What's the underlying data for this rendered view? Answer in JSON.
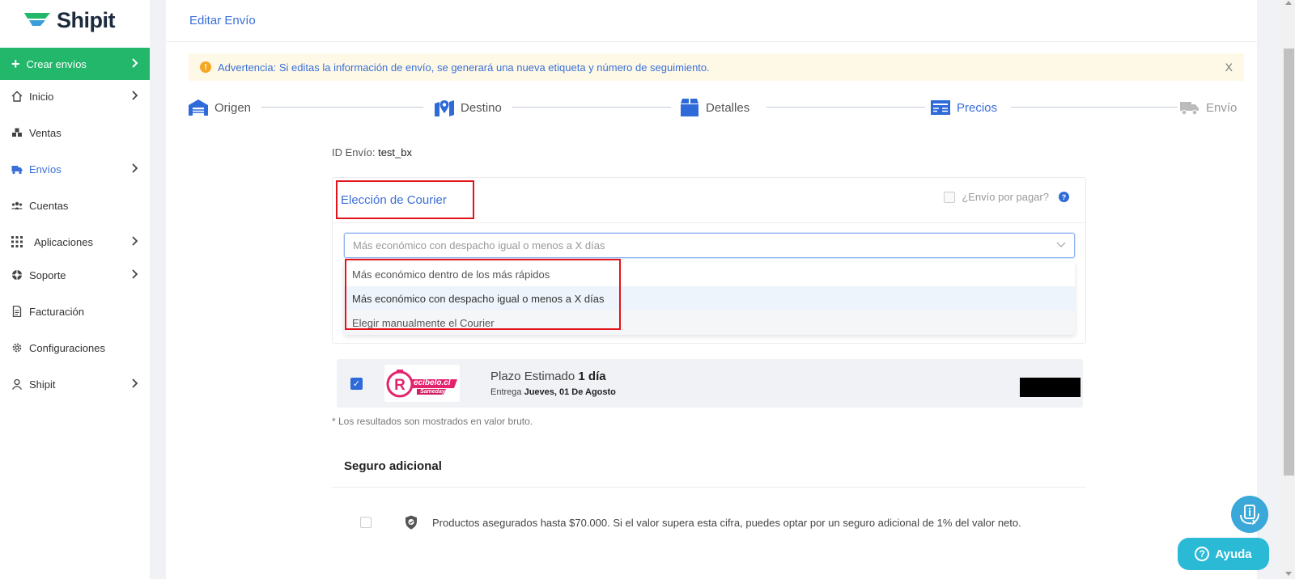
{
  "app": {
    "brand": "Shipit"
  },
  "sidebar": {
    "create_label": "Crear envíos",
    "items": [
      {
        "label": "Inicio",
        "icon": "home-icon",
        "chevron": true
      },
      {
        "label": "Ventas",
        "icon": "boxes-icon",
        "chevron": false
      },
      {
        "label": "Envíos",
        "icon": "truck-icon",
        "chevron": true,
        "active": true
      },
      {
        "label": "Cuentas",
        "icon": "users-icon",
        "chevron": false
      },
      {
        "label": "Aplicaciones",
        "icon": "grid-icon",
        "chevron": true
      },
      {
        "label": "Soporte",
        "icon": "lifebuoy-icon",
        "chevron": true
      },
      {
        "label": "Facturación",
        "icon": "invoice-icon",
        "chevron": false
      },
      {
        "label": "Configuraciones",
        "icon": "gear-icon",
        "chevron": false
      },
      {
        "label": "Shipit",
        "icon": "user-icon",
        "chevron": true
      }
    ]
  },
  "header": {
    "title": "Editar Envío"
  },
  "alert": {
    "text": "Advertencia: Si editas la información de envío, se generará una nueva etiqueta y número de seguimiento.",
    "close": "X"
  },
  "steps": [
    {
      "label": "Origen",
      "icon": "warehouse-icon",
      "state": "done"
    },
    {
      "label": "Destino",
      "icon": "map-pin-icon",
      "state": "done"
    },
    {
      "label": "Detalles",
      "icon": "box-icon",
      "state": "done"
    },
    {
      "label": "Precios",
      "icon": "price-card-icon",
      "state": "current"
    },
    {
      "label": "Envío",
      "icon": "truck-icon",
      "state": "future"
    }
  ],
  "shipment": {
    "id_label": "ID Envío:",
    "id_value": "test_bx"
  },
  "courier_card": {
    "title": "Elección de Courier",
    "pay_label": "¿Envío por pagar?",
    "select_placeholder": "Más económico con despacho igual o menos a X días",
    "options": [
      "Más económico dentro de los más rápidos",
      "Más económico con despacho igual o menos a X días",
      "Elegir manualmente el Courier"
    ]
  },
  "courier_result": {
    "logo_text": "ecibelo.cl",
    "logo_sub": "Sameday",
    "plazo_label": "Plazo Estimado",
    "plazo_value": "1 día",
    "entrega_label": "Entrega",
    "entrega_value": "Jueves, 01 De Agosto"
  },
  "note": "* Los resultados son mostrados en valor bruto.",
  "seguro": {
    "title": "Seguro adicional",
    "text": "Productos asegurados hasta $70.000. Si el valor supera esta cifra, puedes optar por un seguro adicional de 1% del valor neto."
  },
  "help": {
    "label": "Ayuda"
  },
  "colors": {
    "accent": "#3a6fd8",
    "brand_green": "#22b76b",
    "highlight_red": "#e3131b",
    "help_teal": "#2bbad6"
  }
}
